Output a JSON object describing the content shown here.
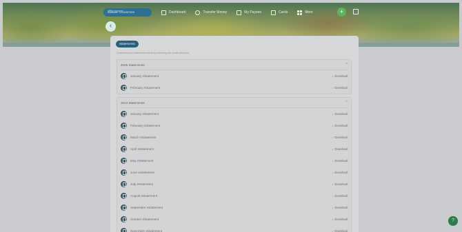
{
  "header": {
    "account_label": "Account: 1234567890",
    "account_sub": "Utility Account",
    "nav": [
      {
        "label": "Dashboard",
        "icon": "dashboard-icon"
      },
      {
        "label": "Transfer Money",
        "icon": "transfer-icon"
      },
      {
        "label": "My Payees",
        "icon": "payees-icon"
      },
      {
        "label": "Cards",
        "icon": "card-icon"
      },
      {
        "label": "More",
        "icon": "grid-icon"
      }
    ],
    "plus": "+",
    "back": "‹"
  },
  "card": {
    "title": "Statements",
    "description": "Download your statements below by selecting the month and year."
  },
  "sections": [
    {
      "title": "2025 Statements",
      "chevron": "^",
      "rows": [
        {
          "label": "January eStatement",
          "download": "Download"
        },
        {
          "label": "February eStatement",
          "download": "Download"
        }
      ]
    },
    {
      "title": "2024 Statements",
      "chevron": "^",
      "rows": [
        {
          "label": "January eStatement",
          "download": "Download"
        },
        {
          "label": "February eStatement",
          "download": "Download"
        },
        {
          "label": "March eStatement",
          "download": "Download"
        },
        {
          "label": "April eStatement",
          "download": "Download"
        },
        {
          "label": "May eStatement",
          "download": "Download"
        },
        {
          "label": "June eStatement",
          "download": "Download"
        },
        {
          "label": "July eStatement",
          "download": "Download"
        },
        {
          "label": "August eStatement",
          "download": "Download"
        },
        {
          "label": "September eStatement",
          "download": "Download"
        },
        {
          "label": "October eStatement",
          "download": "Download"
        },
        {
          "label": "November eStatement",
          "download": "Download"
        }
      ]
    }
  ],
  "chat": {
    "label": "?"
  },
  "colors": {
    "accent": "#2a5e7d",
    "green": "#5db35d",
    "chat": "#2d7a4b"
  }
}
